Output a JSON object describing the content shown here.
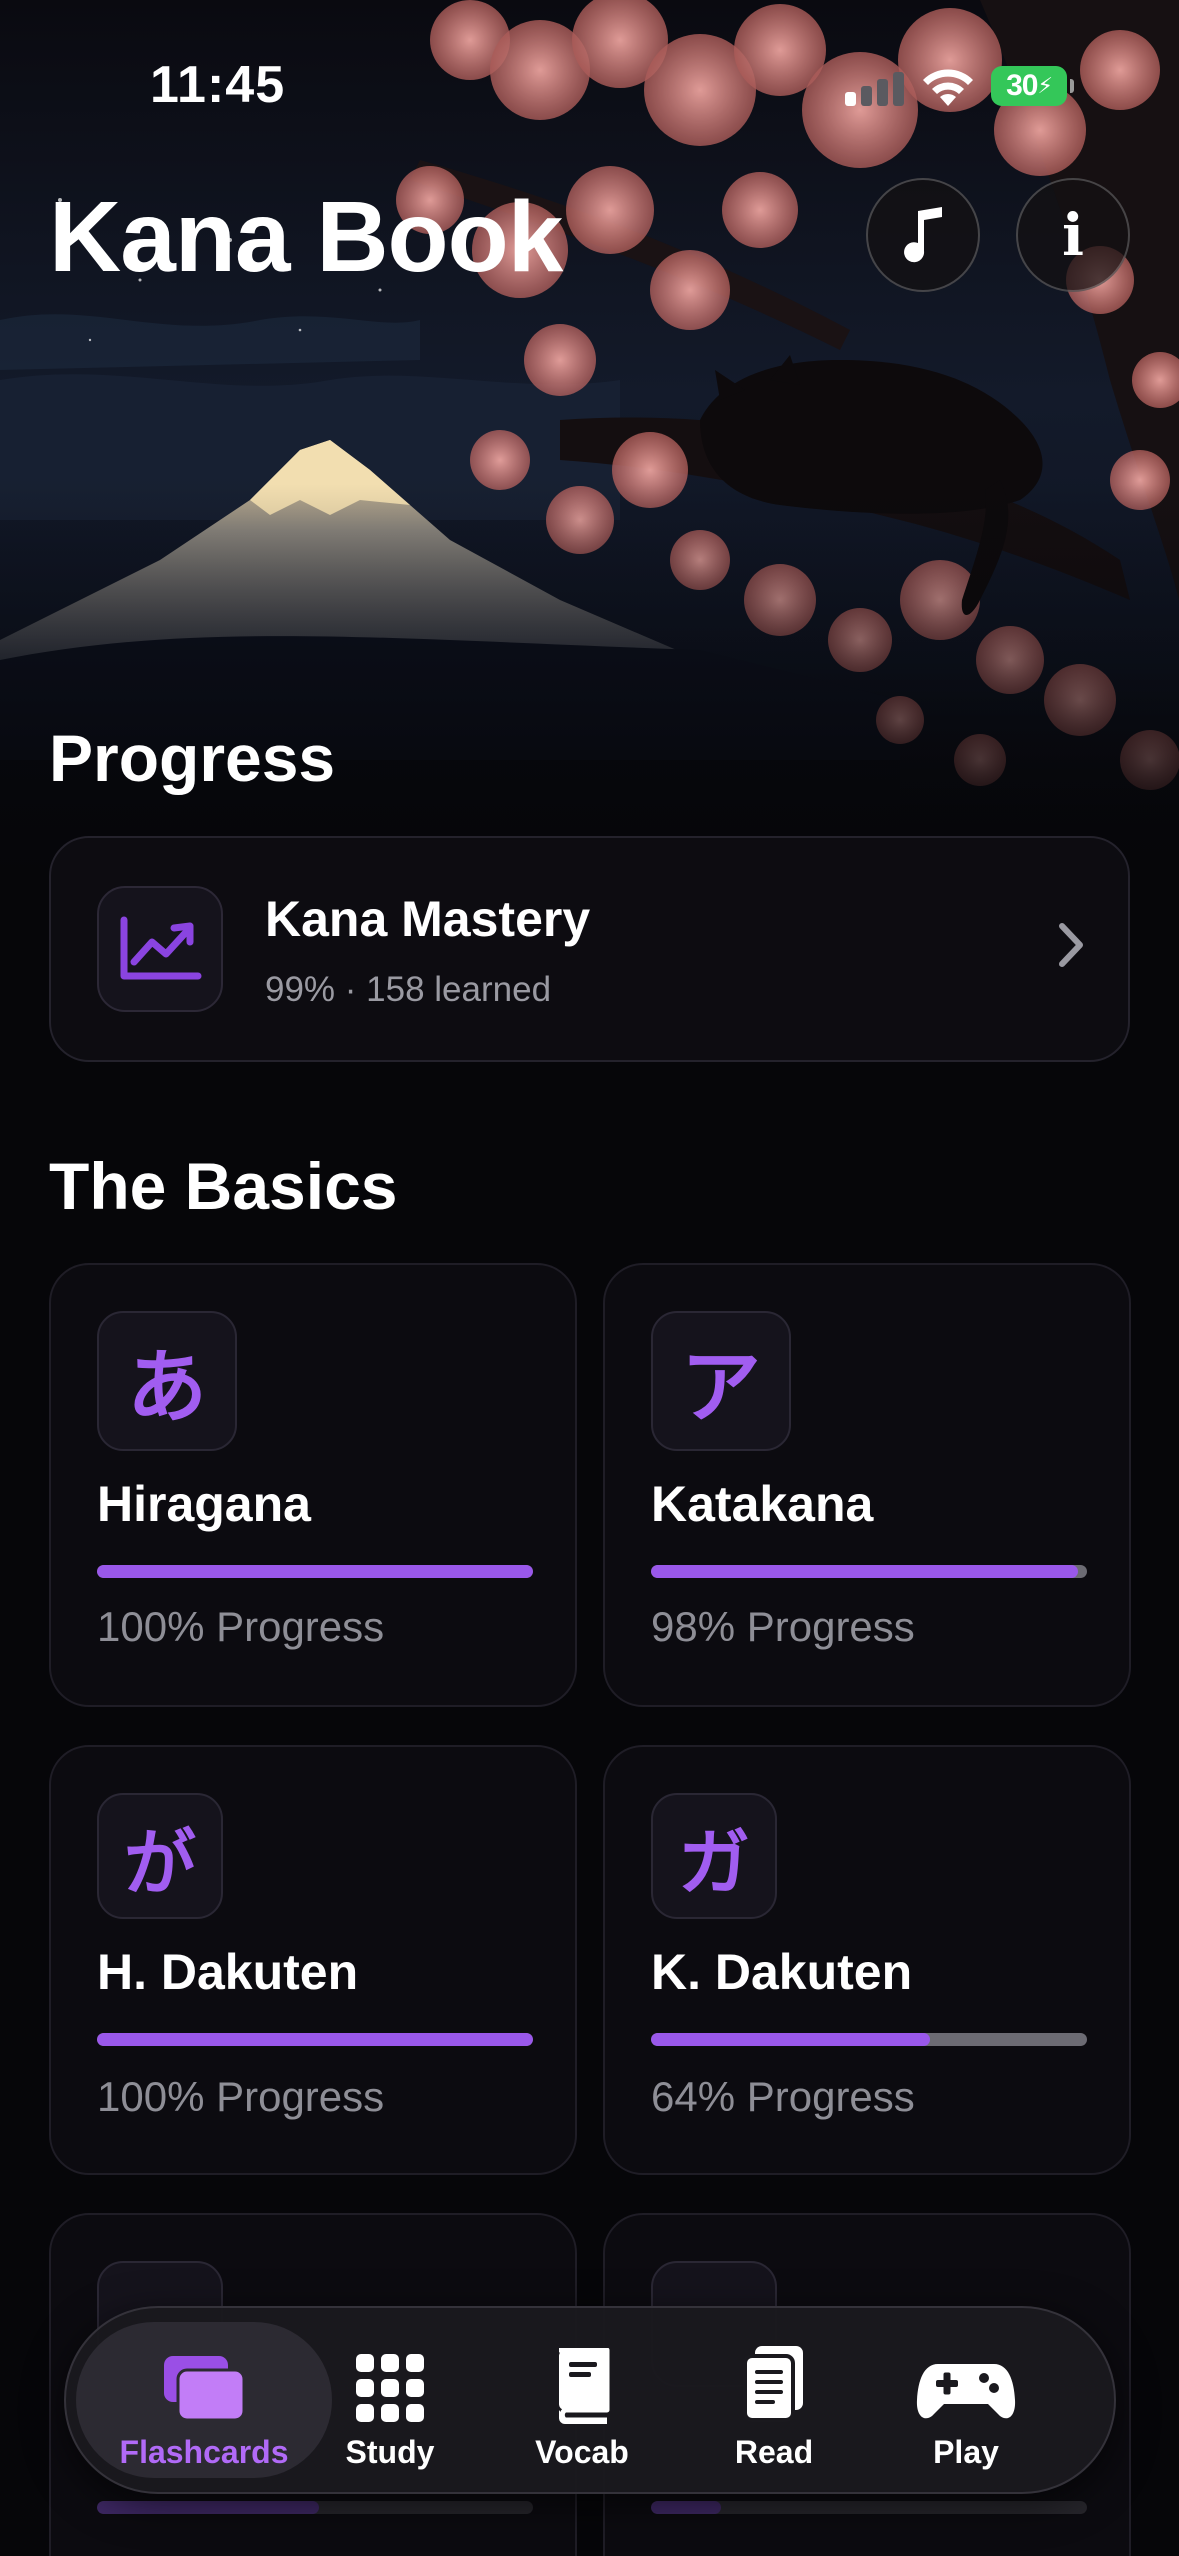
{
  "status_bar": {
    "time": "11:45",
    "battery": "30"
  },
  "header": {
    "title": "Kana Book"
  },
  "progress_section": {
    "title": "Progress",
    "mastery": {
      "name": "Kana Mastery",
      "subtitle": "99% · 158 learned"
    }
  },
  "basics_section": {
    "title": "The Basics",
    "cards": [
      {
        "glyph": "あ",
        "name": "Hiragana",
        "progress_label": "100% Progress",
        "progress": 1.0
      },
      {
        "glyph": "ア",
        "name": "Katakana",
        "progress_label": "98% Progress",
        "progress": 0.98
      },
      {
        "glyph": "が",
        "name": "H. Dakuten",
        "progress_label": "100% Progress",
        "progress": 1.0
      },
      {
        "glyph": "ガ",
        "name": "K. Dakuten",
        "progress_label": "64% Progress",
        "progress": 0.64
      },
      {
        "progress": 0.51
      },
      {
        "progress": 0.16
      }
    ]
  },
  "tabbar": {
    "tabs": [
      {
        "label": "Flashcards",
        "icon": "cards-icon",
        "active": true
      },
      {
        "label": "Study",
        "icon": "grid-icon",
        "active": false
      },
      {
        "label": "Vocab",
        "icon": "book-icon",
        "active": false
      },
      {
        "label": "Read",
        "icon": "document-icon",
        "active": false
      },
      {
        "label": "Play",
        "icon": "gamepad-icon",
        "active": false
      }
    ]
  },
  "colors": {
    "accent": "#9a58ea",
    "accent_light": "#b16af7",
    "battery": "#34c759",
    "background": "#060609"
  }
}
